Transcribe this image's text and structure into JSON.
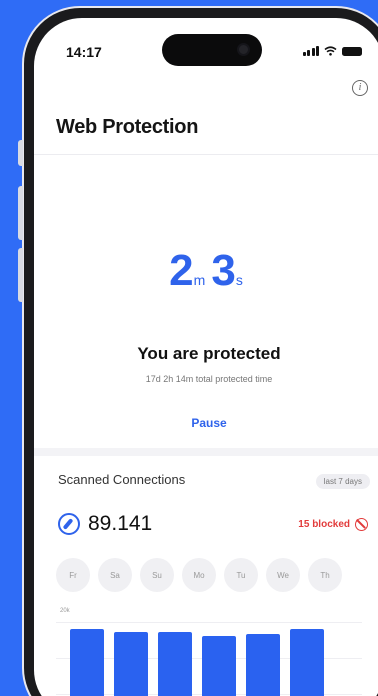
{
  "status": {
    "time": "14:17"
  },
  "header": {
    "title": "Web Protection",
    "info_icon": "info-icon"
  },
  "timer": {
    "minutes": "2",
    "minutes_unit": "m",
    "seconds": "3",
    "seconds_unit": "s"
  },
  "protection": {
    "status": "You are protected",
    "total_time": "17d 2h 14m total protected time",
    "pause_label": "Pause"
  },
  "scanned": {
    "title": "Scanned Connections",
    "period": "last 7 days",
    "count": "89.141",
    "blocked": "15 blocked",
    "days": [
      "Fr",
      "Sa",
      "Su",
      "Mo",
      "Tu",
      "We",
      "Th"
    ]
  },
  "chart_data": {
    "type": "bar",
    "categories": [
      "Fr",
      "Sa",
      "Su",
      "Mo",
      "Tu",
      "We"
    ],
    "values": [
      18.5,
      18,
      18,
      17,
      17.5,
      18.5
    ],
    "ylim": [
      0,
      20
    ],
    "ylabel": "",
    "tick_top": "20k",
    "color": "#2a62f0"
  }
}
